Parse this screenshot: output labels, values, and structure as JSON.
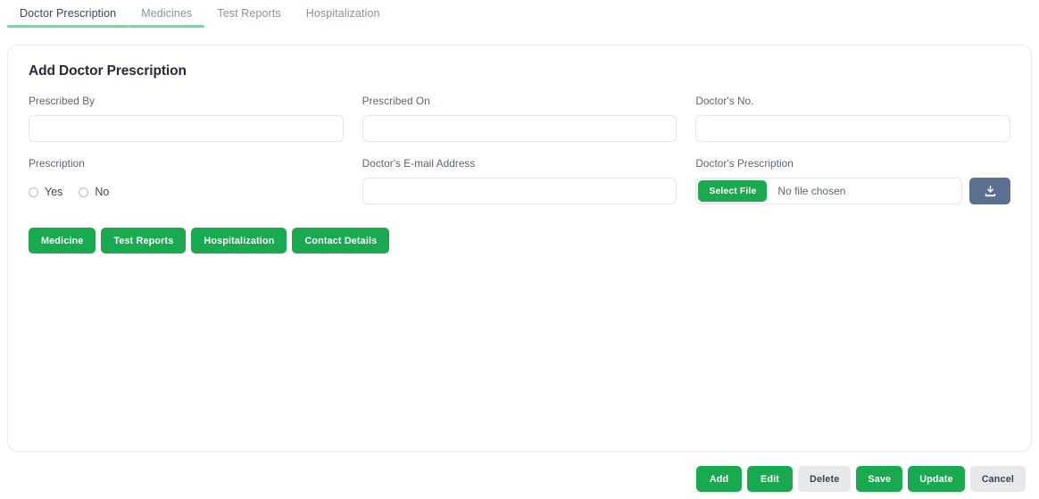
{
  "tabs": [
    {
      "label": "Doctor Prescription",
      "active": true,
      "underline": true
    },
    {
      "label": "Medicines",
      "active": false,
      "underline": true
    },
    {
      "label": "Test Reports",
      "active": false,
      "underline": false
    },
    {
      "label": "Hospitalization",
      "active": false,
      "underline": false
    }
  ],
  "card": {
    "title": "Add Doctor Prescription"
  },
  "form": {
    "prescribed_by": {
      "label": "Prescribed By",
      "value": "",
      "placeholder": ""
    },
    "prescribed_on": {
      "label": "Prescribed On",
      "value": "",
      "placeholder": ""
    },
    "doctors_no": {
      "label": "Doctor's No.",
      "value": "",
      "placeholder": ""
    },
    "prescription": {
      "label": "Prescription",
      "options": [
        {
          "label": "Yes",
          "selected": false
        },
        {
          "label": "No",
          "selected": false
        }
      ]
    },
    "doctors_email": {
      "label": "Doctor's E-mail Address",
      "value": "",
      "placeholder": ""
    },
    "doctors_prescription": {
      "label": "Doctor's Prescription",
      "select_file_label": "Select File",
      "file_status": "No file chosen",
      "upload_icon": "download-icon"
    }
  },
  "section_buttons": [
    {
      "label": "Medicine"
    },
    {
      "label": "Test Reports"
    },
    {
      "label": "Hospitalization"
    },
    {
      "label": "Contact Details"
    }
  ],
  "footer_buttons": [
    {
      "label": "Add",
      "style": "primary"
    },
    {
      "label": "Edit",
      "style": "primary"
    },
    {
      "label": "Delete",
      "style": "muted"
    },
    {
      "label": "Save",
      "style": "primary"
    },
    {
      "label": "Update",
      "style": "primary"
    },
    {
      "label": "Cancel",
      "style": "muted"
    }
  ],
  "colors": {
    "accent_green": "#19a94f",
    "tab_underline": "#84cfa7",
    "upload_button": "#5c6f91",
    "muted_button": "#e6e8ec",
    "border": "#e4e7ea"
  }
}
